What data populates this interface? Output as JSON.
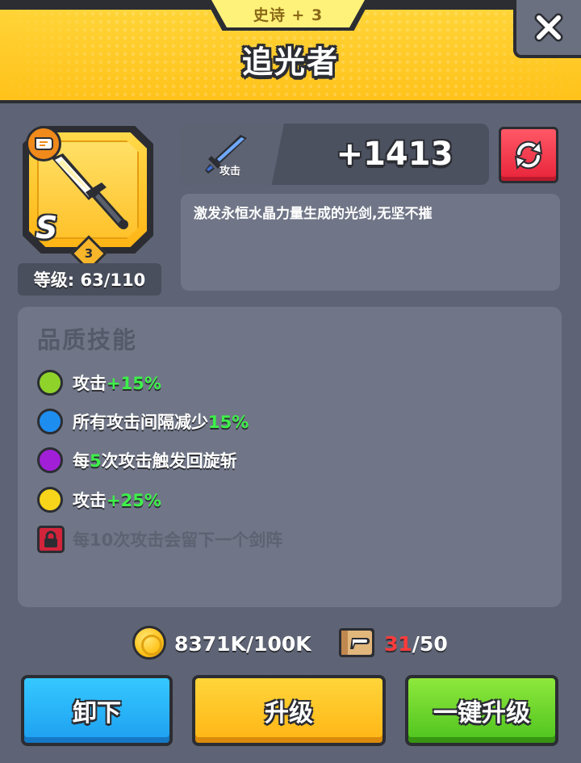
{
  "header": {
    "rarity": "史诗 + 3",
    "title": "追光者"
  },
  "item": {
    "grade": "S",
    "star_level": "3",
    "level_label": "等级: 63/110",
    "icons": [
      "scroll-icon",
      "sword-icon"
    ]
  },
  "stat": {
    "label": "攻击",
    "value": "+1413",
    "icon": "sword-icon"
  },
  "description": "激发永恒水晶力量生成的光剑,无坚不摧",
  "skills": {
    "title": "品质技能",
    "items": [
      {
        "prefix": "攻击",
        "highlight": "+15%",
        "suffix": "",
        "color": "#8fd22a",
        "locked": false
      },
      {
        "prefix": "所有攻击间隔减少",
        "highlight": "15%",
        "suffix": "",
        "color": "#1e8df0",
        "locked": false
      },
      {
        "prefix": "每",
        "highlight": "5",
        "suffix": "次攻击触发回旋斩",
        "color": "#a21fd8",
        "locked": false
      },
      {
        "prefix": "攻击",
        "highlight": "+25%",
        "suffix": "",
        "color": "#f6d51a",
        "locked": false
      },
      {
        "prefix": "每10次攻击会留下一个剑阵",
        "highlight": "",
        "suffix": "",
        "color": "#d2243b",
        "locked": true
      }
    ]
  },
  "resources": {
    "coins": "8371K/100K",
    "scrolls_have": "31",
    "scrolls_need": "/50"
  },
  "buttons": {
    "unequip": "卸下",
    "upgrade": "升级",
    "one_click_upgrade": "一键升级"
  },
  "colors": {
    "header_yellow": "#ffc21a",
    "background": "#5e6475",
    "highlight_green": "#3ef04a",
    "refresh_red": "#e8233a",
    "button_blue": "#1d9ff0",
    "button_yellow": "#ffb514",
    "button_green": "#4ec31e"
  }
}
